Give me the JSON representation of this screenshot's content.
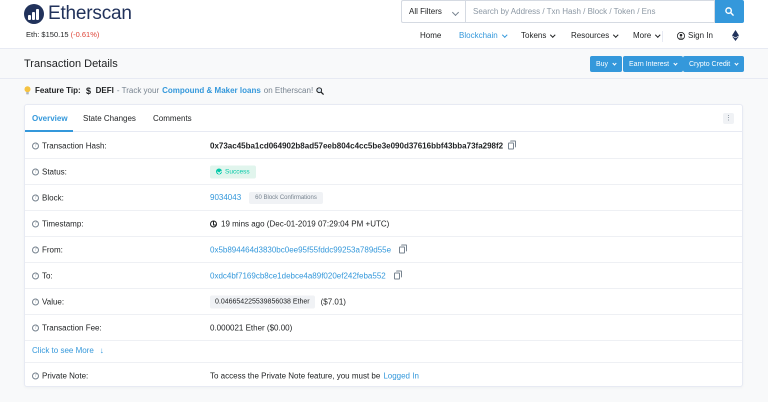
{
  "header": {
    "logo_text": "Etherscan",
    "eth_price_label": "Eth: $150.15",
    "eth_price_change": "(-0.61%)",
    "search": {
      "filter_label": "All Filters",
      "placeholder": "Search by Address / Txn Hash / Block / Token / Ens"
    },
    "nav": [
      {
        "label": "Home"
      },
      {
        "label": "Blockchain"
      },
      {
        "label": "Tokens"
      },
      {
        "label": "Resources"
      },
      {
        "label": "More"
      },
      {
        "label": "Sign In"
      }
    ]
  },
  "titlebar": {
    "title": "Transaction Details",
    "buttons": [
      {
        "label": "Buy"
      },
      {
        "label": "Earn Interest"
      },
      {
        "label": "Crypto Credit"
      }
    ]
  },
  "tip": {
    "prefix": "Feature Tip:",
    "defi": "DEFI",
    "text1": "- Track your",
    "link": "Compound & Maker loans",
    "text2": "on Etherscan!"
  },
  "tabs": [
    {
      "label": "Overview"
    },
    {
      "label": "State Changes"
    },
    {
      "label": "Comments"
    }
  ],
  "details": {
    "hash_label": "Transaction Hash:",
    "hash": "0x73ac45ba1cd064902b8ad57eeb804c4cc5be3e090d37616bbf43bba73fa298f2",
    "status_label": "Status:",
    "status": "Success",
    "block_label": "Block:",
    "block": "9034043",
    "confirmations": "60 Block Confirmations",
    "timestamp_label": "Timestamp:",
    "timestamp": "19 mins ago (Dec-01-2019 07:29:04 PM +UTC)",
    "from_label": "From:",
    "from": "0x5b894464d3830bc0ee95f55fddc99253a789d55e",
    "to_label": "To:",
    "to": "0xdc4bf7169cb8ce1debce4a89f020ef242feba552",
    "value_label": "Value:",
    "value_ether": "0.046654225539856038 Ether",
    "value_usd": "($7.01)",
    "fee_label": "Transaction Fee:",
    "fee": "0.000021 Ether ($0.00)",
    "see_more": "Click to see More",
    "note_label": "Private Note:",
    "note_text": "To access the Private Note feature, you must be",
    "note_link": "Logged In"
  },
  "colors": {
    "accent": "#3498db",
    "success": "#00c9a7",
    "negative": "#de4437"
  }
}
